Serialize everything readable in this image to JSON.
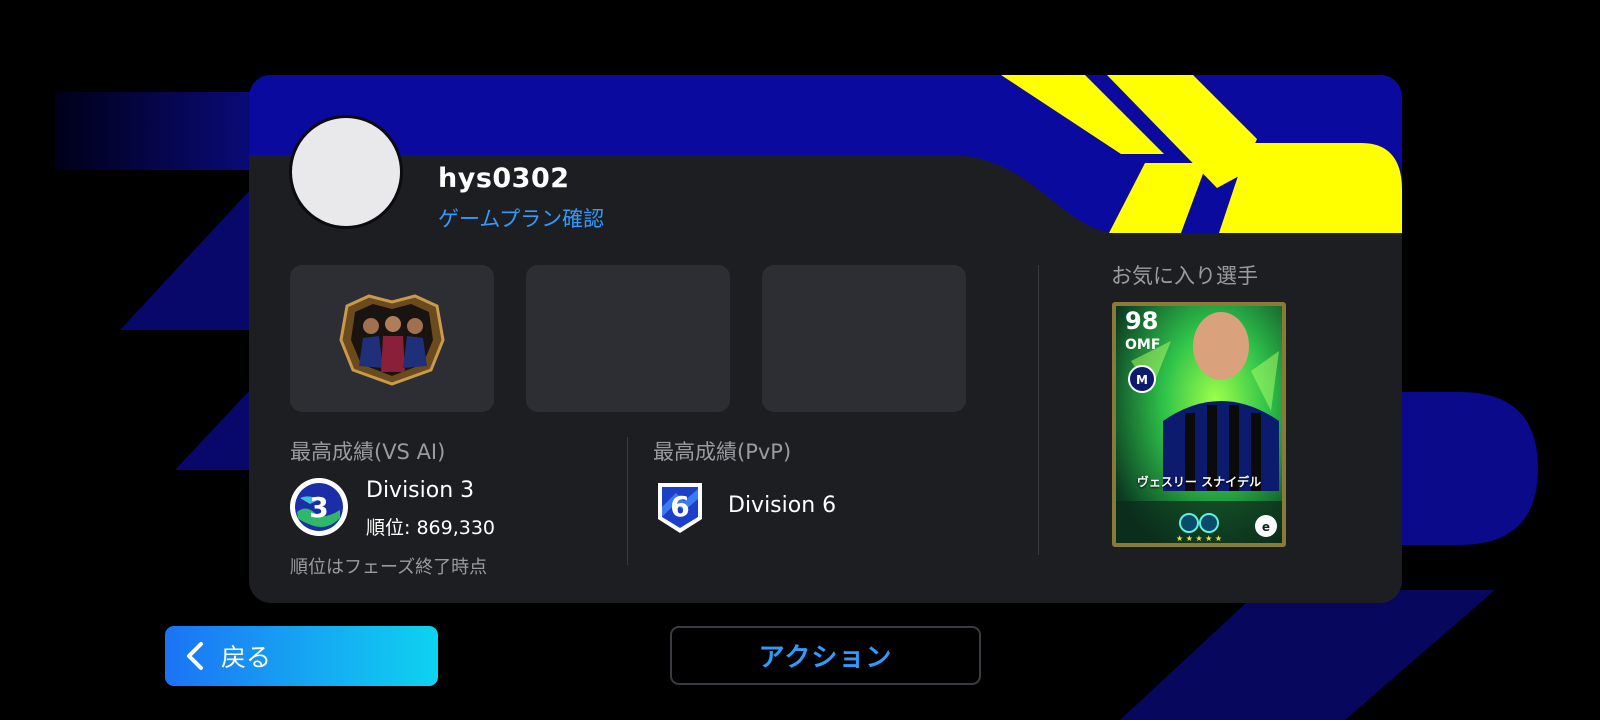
{
  "profile": {
    "username": "hys0302",
    "gameplan_link": "ゲームプラン確認"
  },
  "records": {
    "vs_ai": {
      "label": "最高成績(VS AI)",
      "division_number": "3",
      "division_name": "Division 3",
      "rank_text": "順位: 869,330",
      "note": "順位はフェーズ終了時点"
    },
    "pvp": {
      "label": "最高成績(PvP)",
      "division_number": "6",
      "division_name": "Division 6"
    }
  },
  "favorite": {
    "label": "お気に入り選手",
    "player": {
      "rating": "98",
      "position": "OMF",
      "name": "ヴェスリー スナイデル"
    }
  },
  "buttons": {
    "back_label": "戻る",
    "action_label": "アクション"
  },
  "colors": {
    "accent_blue": "#2f9bff",
    "header_navy": "#0a0a9e",
    "header_yellow": "#ffff00",
    "card_bg": "#1d1e22",
    "slot_bg": "#2d2e33",
    "back_gradient_start": "#1b73f5",
    "back_gradient_end": "#0ed3f0"
  },
  "icons": {
    "back": "chevron-left-icon",
    "emblem": "team-emblem-icon",
    "division_ai": "division-3-badge-icon",
    "division_pvp": "division-6-badge-icon",
    "club": "club-crest-icon",
    "brand": "efootball-logo-icon"
  }
}
